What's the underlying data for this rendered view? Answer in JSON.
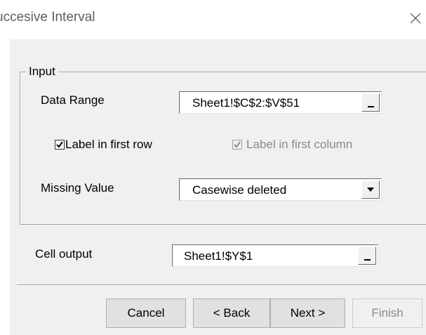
{
  "window": {
    "title": "uccesive Interval",
    "close_glyph": "✕"
  },
  "input_group": {
    "legend": "Input",
    "data_range": {
      "label": "Data Range",
      "value": "Sheet1!$C$2:$V$51"
    },
    "label_first_row": {
      "label": "Label in first row",
      "checked": true
    },
    "label_first_column": {
      "label": "Label in first column",
      "checked": true,
      "enabled": false
    },
    "missing_value": {
      "label": "Missing Value",
      "selected": "Casewise deleted"
    }
  },
  "output": {
    "label": "Cell output",
    "value": "Sheet1!$Y$1"
  },
  "buttons": {
    "cancel": "Cancel",
    "back": "< Back",
    "next": "Next >",
    "finish": "Finish"
  },
  "icons": {
    "close": "close-icon",
    "checkmark": "checkmark-icon",
    "dropdown": "chevron-down-icon",
    "range_select": "range-select-icon"
  },
  "colors": {
    "dialog_background": "#f0f0f0",
    "titlebar_background": "#ffffff",
    "title_text": "#5f5f5f",
    "disabled_text": "#8a8a8a",
    "button_face": "#e1e1e1",
    "button_border": "#adadad"
  }
}
